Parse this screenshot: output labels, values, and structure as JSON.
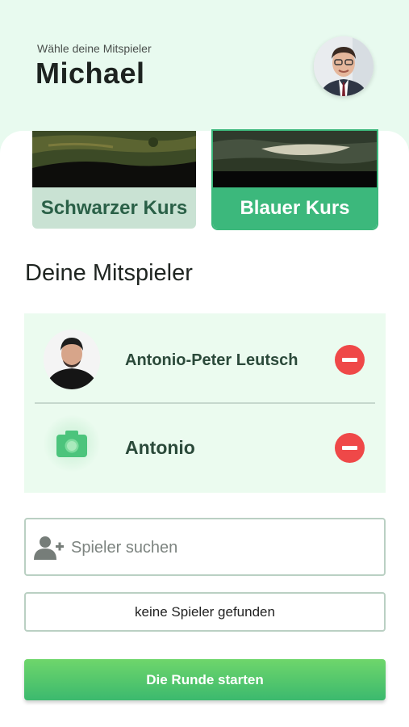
{
  "header": {
    "subtitle": "Wähle deine Mitspieler",
    "title": "Michael",
    "avatar_icon": "user-photo"
  },
  "courses": [
    {
      "label": "Schwarzer Kurs",
      "selected": false
    },
    {
      "label": "Blauer Kurs",
      "selected": true
    }
  ],
  "section_title": "Deine Mitspieler",
  "players": [
    {
      "name": "Antonio-Peter Leutsch",
      "avatar": "photo",
      "remove_icon": "minus-circle-icon"
    },
    {
      "name": "Antonio",
      "avatar": "camera-icon",
      "remove_icon": "minus-circle-icon"
    }
  ],
  "search": {
    "placeholder": "Spieler suchen",
    "value": "",
    "icon": "add-user-icon"
  },
  "empty_message": "keine Spieler gefunden",
  "start_button": "Die Runde starten",
  "colors": {
    "header_bg": "#e8faef",
    "accent": "#3cb87c",
    "danger": "#ef4848",
    "players_bg": "#ebfbef"
  }
}
